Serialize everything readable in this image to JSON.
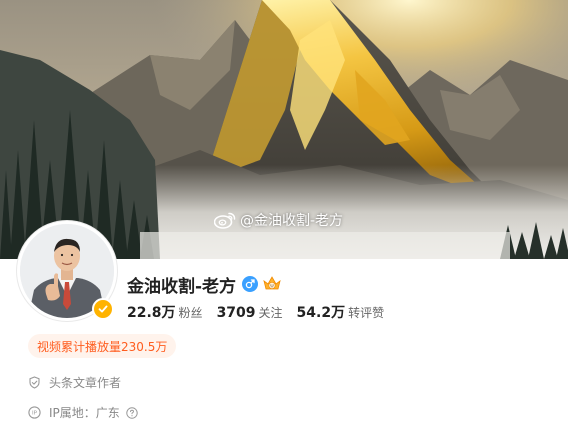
{
  "banner": {
    "watermark": "@金油收割-老方",
    "watermark_icon": "weibo-logo-icon"
  },
  "profile": {
    "name": "金油收割-老方",
    "gender_icon": "male-icon",
    "level_icon": "crown-level-icon",
    "verified_icon": "verified-badge-icon",
    "verified_color": "#ffb300"
  },
  "stats": [
    {
      "value": "22.8万",
      "label": "粉丝"
    },
    {
      "value": "3709",
      "label": "关注"
    },
    {
      "value": "54.2万",
      "label": "转评赞"
    }
  ],
  "play_badge": "视频累计播放量230.5万",
  "info": {
    "role": "头条文章作者",
    "role_icon": "shield-check-icon",
    "ip": "IP属地：广东",
    "ip_icon": "ip-location-icon",
    "help_icon": "question-circle-icon"
  },
  "colors": {
    "accent_orange": "#ff5d1f",
    "badge_bg": "#fff3ec",
    "gender_blue": "#3aa0ff"
  }
}
